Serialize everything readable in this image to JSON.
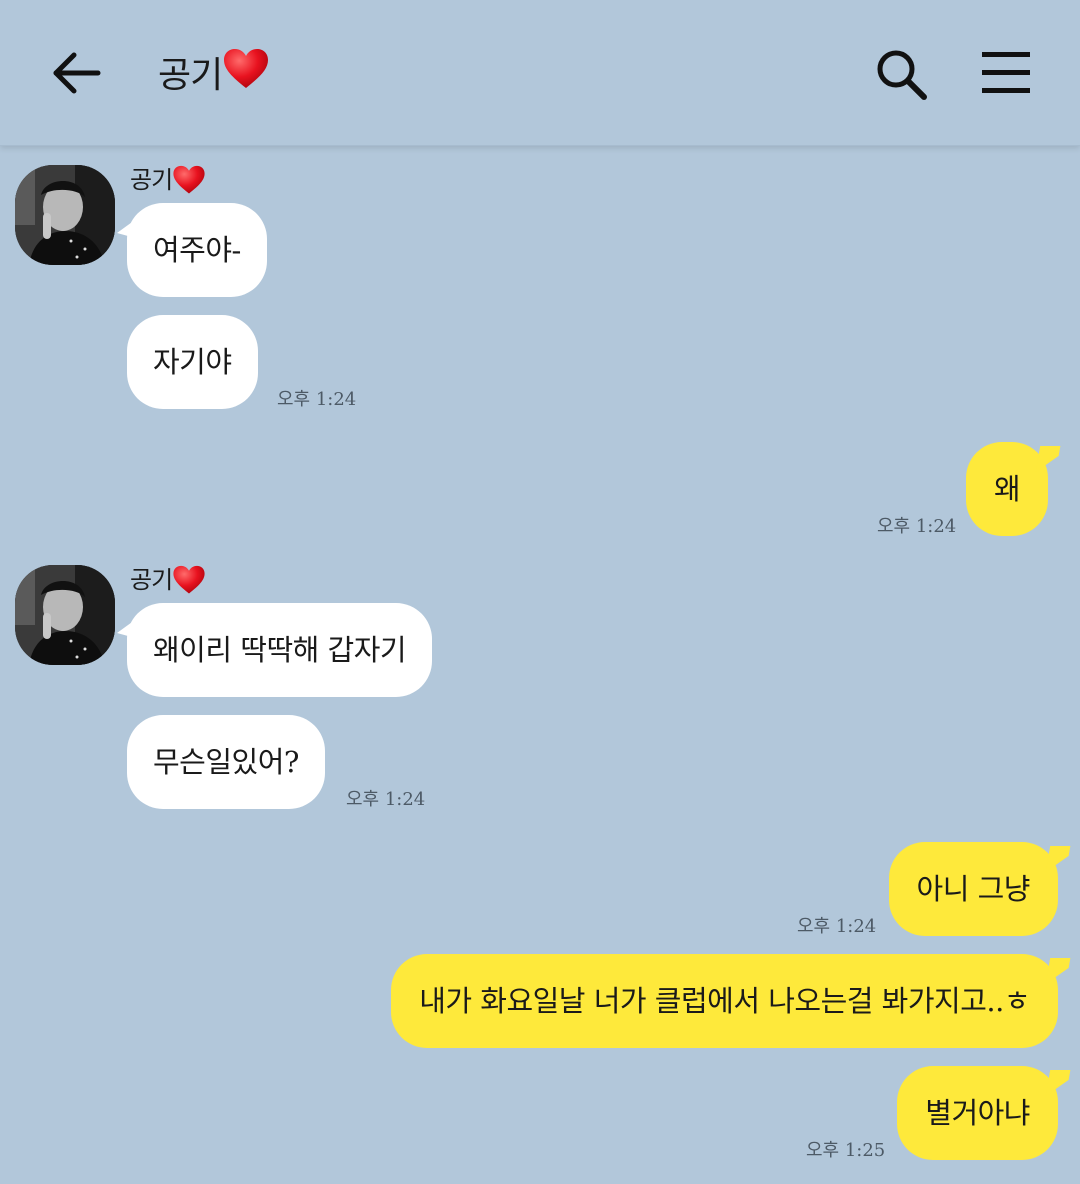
{
  "header": {
    "title": "공기",
    "title_heart": "❤"
  },
  "messages": [
    {
      "sender": "공기",
      "text": "여주야-",
      "direction": "in"
    },
    {
      "sender": "공기",
      "text": "자기야",
      "direction": "in",
      "time": "오후 1:24"
    },
    {
      "sender": "me",
      "text": "왜",
      "direction": "out",
      "time": "오후 1:24"
    },
    {
      "sender": "공기",
      "text": "왜이리 딱딱해 갑자기",
      "direction": "in"
    },
    {
      "sender": "공기",
      "text": "무슨일있어?",
      "direction": "in",
      "time": "오후 1:24"
    },
    {
      "sender": "me",
      "text": "아니 그냥",
      "direction": "out",
      "time": "오후 1:24"
    },
    {
      "sender": "me",
      "text": "내가 화요일날 너가 클럽에서 나오는걸 봐가지고..ㅎ",
      "direction": "out"
    },
    {
      "sender": "me",
      "text": "별거아냐",
      "direction": "out",
      "time": "오후 1:25"
    }
  ],
  "groups": [
    {
      "sender_name": "공기",
      "sender_heart": "❤",
      "avatar": "profile-photo"
    },
    {
      "sender_name": "공기",
      "sender_heart": "❤",
      "avatar": "profile-photo"
    }
  ],
  "icons": {
    "back": "back-arrow-icon",
    "search": "search-icon",
    "menu": "hamburger-menu-icon",
    "heart": "heart-icon"
  },
  "colors": {
    "background": "#b2c7da",
    "incoming_bubble": "#ffffff",
    "outgoing_bubble": "#fee93b",
    "heart": "#e8121f"
  }
}
